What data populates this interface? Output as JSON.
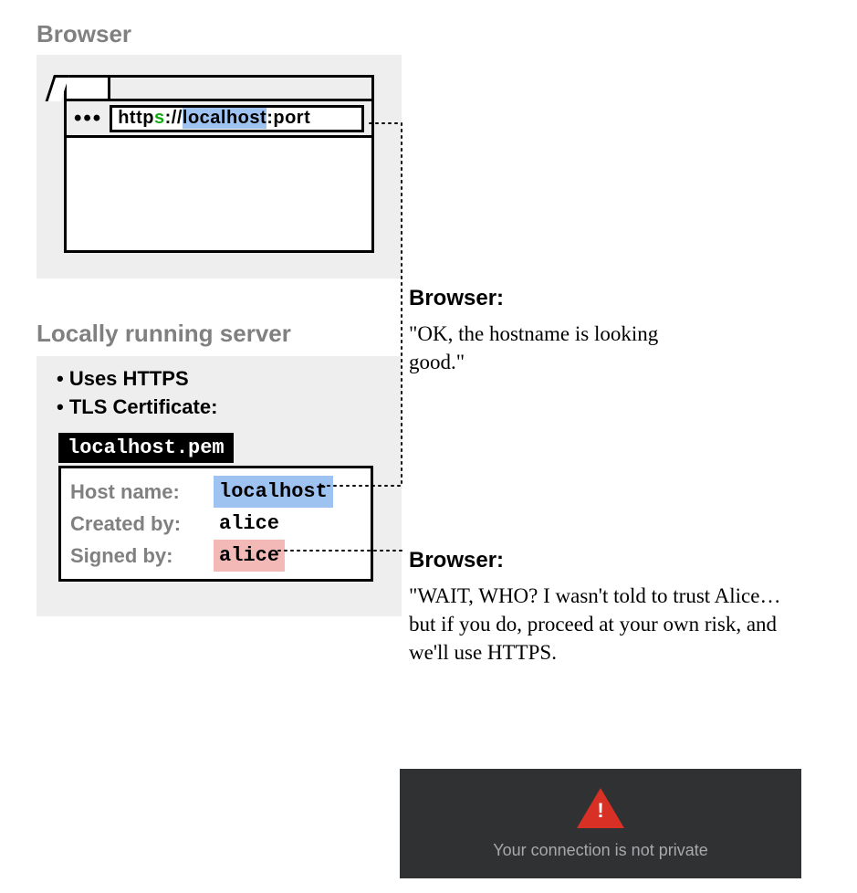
{
  "titles": {
    "browser": "Browser",
    "server": "Locally running server"
  },
  "address": {
    "dots": "•••",
    "pre": "http",
    "s": "s",
    "sep": "://",
    "host": "localhost",
    "colon": ":",
    "port": "port"
  },
  "server": {
    "bullet1": "Uses HTTPS",
    "bullet2": "TLS Certificate:",
    "pem": "localhost.pem",
    "labels": {
      "host": "Host name:",
      "created": "Created by:",
      "signed": "Signed by:"
    },
    "values": {
      "host": "localhost",
      "created": "alice",
      "signed": "alice"
    }
  },
  "speech": {
    "one_title": "Browser:",
    "one_body": "\"OK, the hostname is looking good.\"",
    "two_title": "Browser:",
    "two_body": "\"WAIT, WHO? I wasn't told to trust Alice… but if you do, proceed at your own risk, and we'll use HTTPS."
  },
  "warning": {
    "text": "Your connection is not private"
  }
}
